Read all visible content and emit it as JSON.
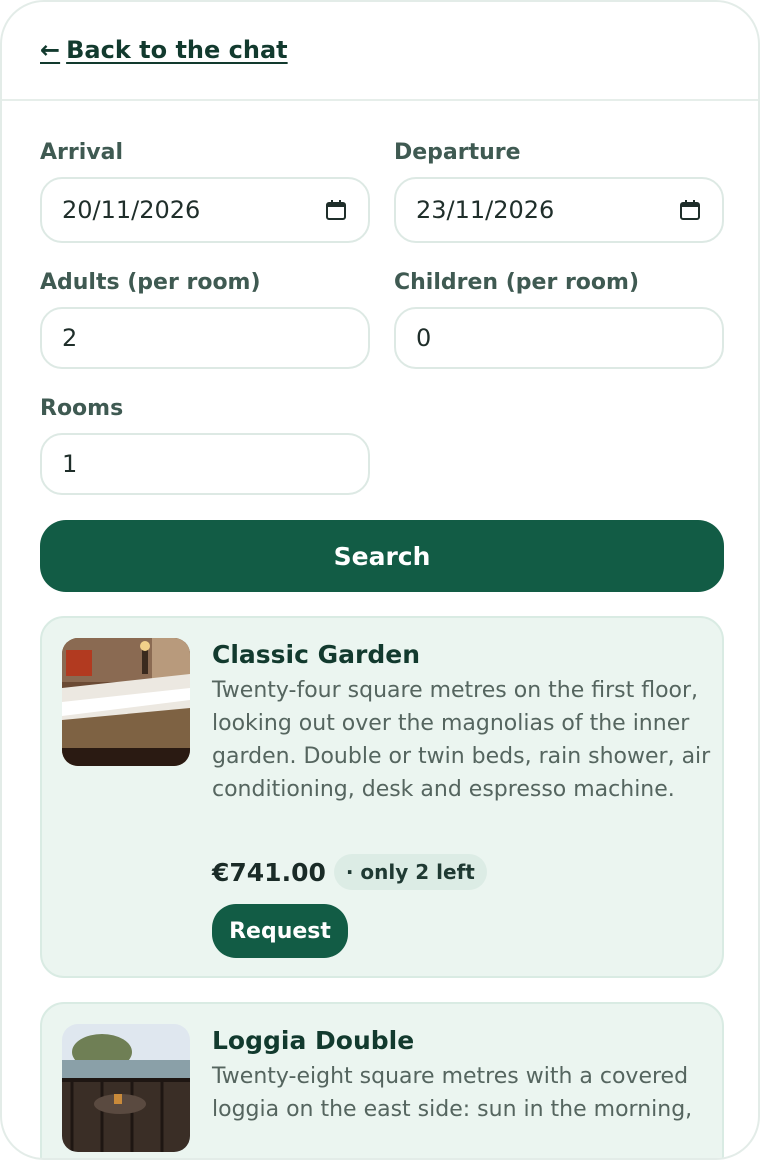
{
  "header": {
    "back_label": "Back to the chat",
    "back_icon": "arrow-left-icon"
  },
  "form": {
    "arrival": {
      "label": "Arrival",
      "value": "20/11/2026",
      "icon": "calendar-icon"
    },
    "departure": {
      "label": "Departure",
      "value": "23/11/2026",
      "icon": "calendar-icon"
    },
    "adults": {
      "label": "Adults (per room)",
      "value": "2"
    },
    "children": {
      "label": "Children (per room)",
      "value": "0"
    },
    "rooms": {
      "label": "Rooms",
      "value": "1"
    },
    "search_label": "Search"
  },
  "results": [
    {
      "title": "Classic Garden",
      "description": "Twenty-four square metres on the first floor, looking out over the magnolias of the inner garden. Double or twin beds, rain shower, air conditioning, desk and espresso machine.",
      "price": "€741.00",
      "availability": "· only 2 left",
      "request_label": "Request"
    },
    {
      "title": "Loggia Double",
      "description": "Twenty-eight square metres with a covered loggia on the east side: sun in the morning,"
    }
  ],
  "colors": {
    "accent": "#125c45",
    "card_bg": "#ebf5f0",
    "badge_bg": "#dcece5"
  }
}
